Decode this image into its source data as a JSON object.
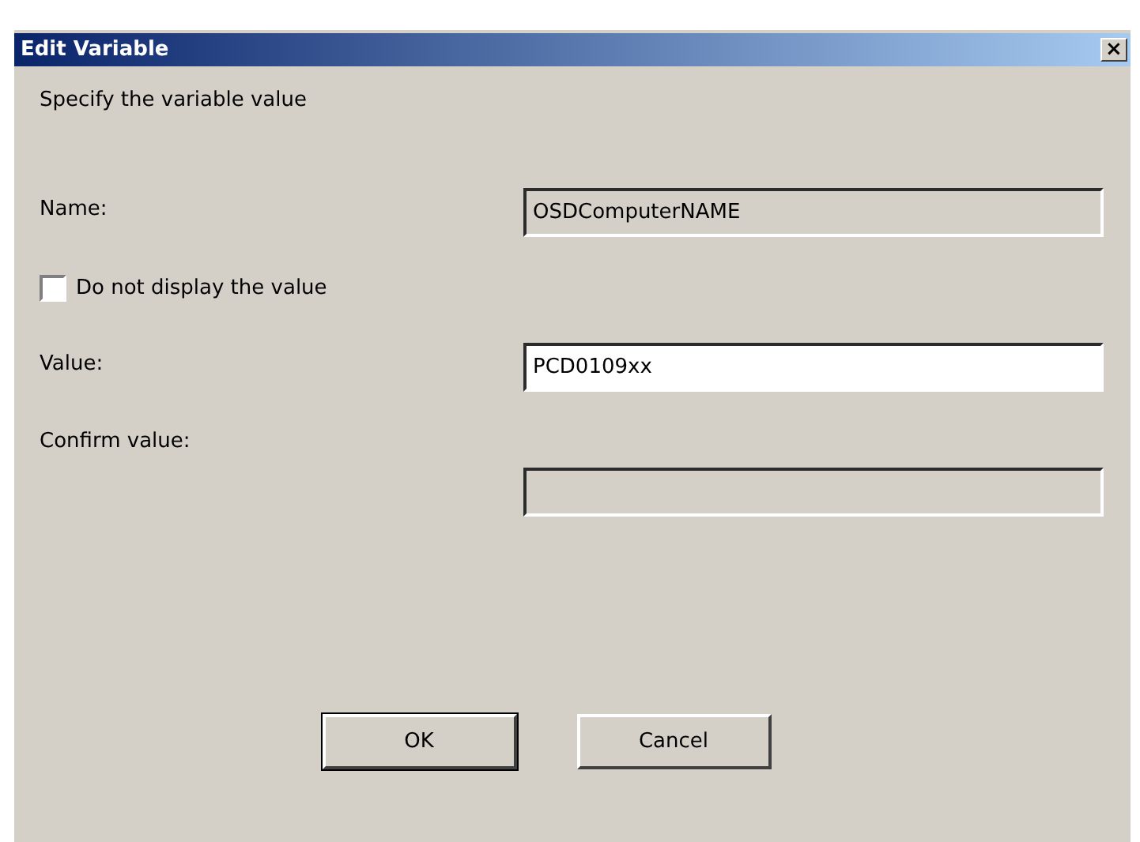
{
  "window": {
    "title": "Edit Variable",
    "close": "×"
  },
  "instruction": "Specify the variable value",
  "rows": [
    {
      "kind": "field",
      "label": "Name:",
      "value": "OSDComputerNAME",
      "disabled": true
    },
    {
      "kind": "checkbox",
      "label": "Do not display the value",
      "checked": false
    },
    {
      "kind": "field",
      "label": "Value:",
      "value": "PCD0109xx",
      "disabled": false
    },
    {
      "kind": "stacked-field",
      "label": "Confirm value:",
      "disabled": true
    }
  ],
  "buttons": [
    {
      "label": "OK",
      "default": true
    },
    {
      "label": "Cancel",
      "default": false
    }
  ]
}
